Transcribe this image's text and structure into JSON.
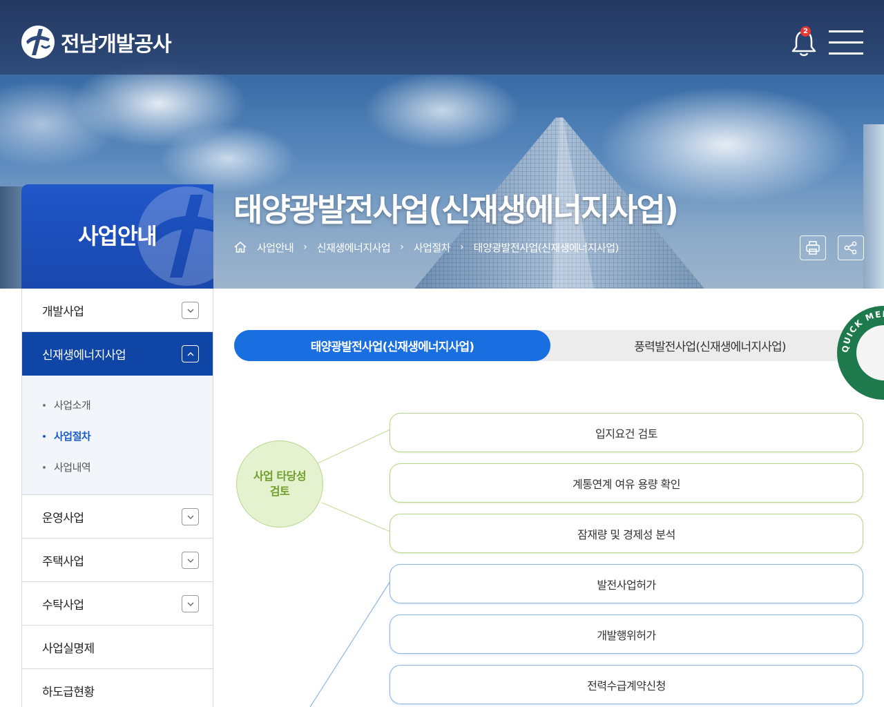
{
  "header": {
    "logo_text": "전남개발공사",
    "notification_count": "2"
  },
  "hero": {
    "section_title": "사업안내",
    "page_title": "태양광발전사업(신재생에너지사업)",
    "breadcrumb": [
      "사업안내",
      "신재생에너지사업",
      "사업절차",
      "태양광발전사업(신재생에너지사업)"
    ]
  },
  "sidenav": {
    "items": [
      {
        "label": "개발사업"
      },
      {
        "label": "신재생에너지사업"
      },
      {
        "label": "운영사업"
      },
      {
        "label": "주택사업"
      },
      {
        "label": "수탁사업"
      },
      {
        "label": "사업실명제"
      },
      {
        "label": "하도급현황"
      }
    ],
    "submenu": [
      {
        "label": "사업소개"
      },
      {
        "label": "사업절차"
      },
      {
        "label": "사업내역"
      }
    ]
  },
  "tabs": [
    {
      "label": "태양광발전사업(신재생에너지사업)"
    },
    {
      "label": "풍력발전사업(신재생에너지사업)"
    }
  ],
  "quick_menu": {
    "label": "QUICK MENU SERVICE"
  },
  "diagram": {
    "circle_label_line1": "사업 타당성",
    "circle_label_line2": "검토",
    "steps": [
      {
        "label": "입지요건 검토"
      },
      {
        "label": "계통연계 여유 용량 확인"
      },
      {
        "label": "잠재량 및 경제성 분석"
      },
      {
        "label": "발전사업허가"
      },
      {
        "label": "개발행위허가"
      },
      {
        "label": "전력수급계약신청"
      }
    ]
  },
  "colors": {
    "primary_blue": "#1a6fe0",
    "nav_active": "#0f45a5",
    "green_accent": "#6f9e2a",
    "quick_menu_green": "#1e7a4c"
  }
}
